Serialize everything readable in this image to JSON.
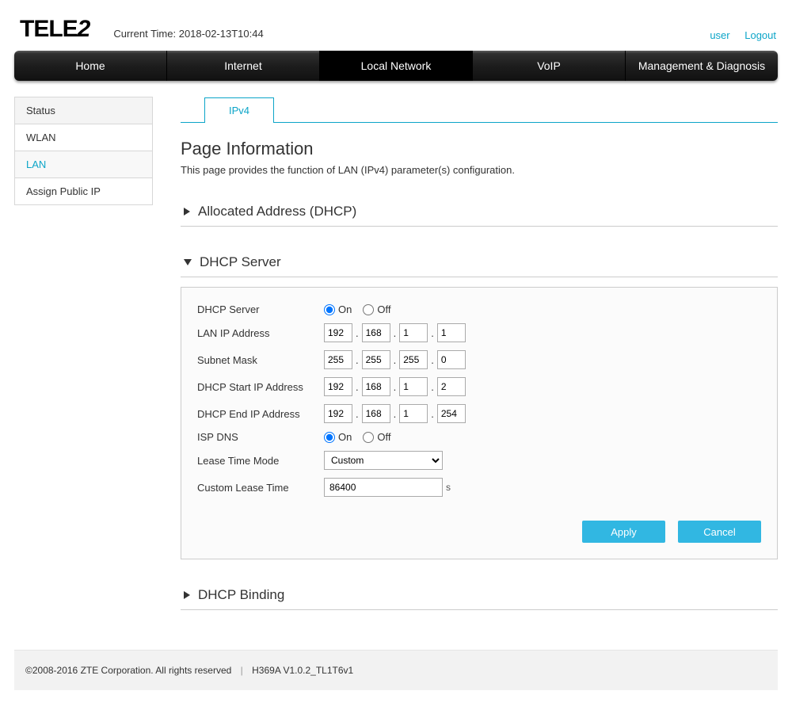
{
  "header": {
    "logo_text": "TELE2",
    "current_time_label": "Current Time: 2018-02-13T10:44",
    "user_link": "user",
    "logout_link": "Logout"
  },
  "nav": {
    "items": [
      "Home",
      "Internet",
      "Local Network",
      "VoIP",
      "Management & Diagnosis"
    ],
    "active_index": 2
  },
  "sidebar": {
    "items": [
      "Status",
      "WLAN",
      "LAN",
      "Assign Public IP"
    ],
    "active_index": 2
  },
  "tabs": {
    "items": [
      "IPv4"
    ],
    "active_index": 0
  },
  "page": {
    "title": "Page Information",
    "description": "This page provides the function of LAN (IPv4) parameter(s) configuration."
  },
  "sections": {
    "allocated": {
      "title": "Allocated Address (DHCP)",
      "expanded": false
    },
    "dhcp_server": {
      "title": "DHCP Server",
      "expanded": true
    },
    "dhcp_binding": {
      "title": "DHCP Binding",
      "expanded": false
    }
  },
  "form": {
    "dhcp_server": {
      "label": "DHCP Server",
      "on_label": "On",
      "off_label": "Off",
      "value": "on"
    },
    "lan_ip": {
      "label": "LAN IP Address",
      "octets": [
        "192",
        "168",
        "1",
        "1"
      ]
    },
    "subnet": {
      "label": "Subnet Mask",
      "octets": [
        "255",
        "255",
        "255",
        "0"
      ]
    },
    "start_ip": {
      "label": "DHCP Start IP Address",
      "octets": [
        "192",
        "168",
        "1",
        "2"
      ]
    },
    "end_ip": {
      "label": "DHCP End IP Address",
      "octets": [
        "192",
        "168",
        "1",
        "254"
      ]
    },
    "isp_dns": {
      "label": "ISP DNS",
      "on_label": "On",
      "off_label": "Off",
      "value": "on"
    },
    "lease_mode": {
      "label": "Lease Time Mode",
      "value": "Custom"
    },
    "custom_lease": {
      "label": "Custom Lease Time",
      "value": "86400",
      "unit": "s"
    },
    "apply_label": "Apply",
    "cancel_label": "Cancel"
  },
  "footer": {
    "copyright": "©2008-2016 ZTE Corporation. All rights reserved",
    "version": "H369A V1.0.2_TL1T6v1"
  }
}
